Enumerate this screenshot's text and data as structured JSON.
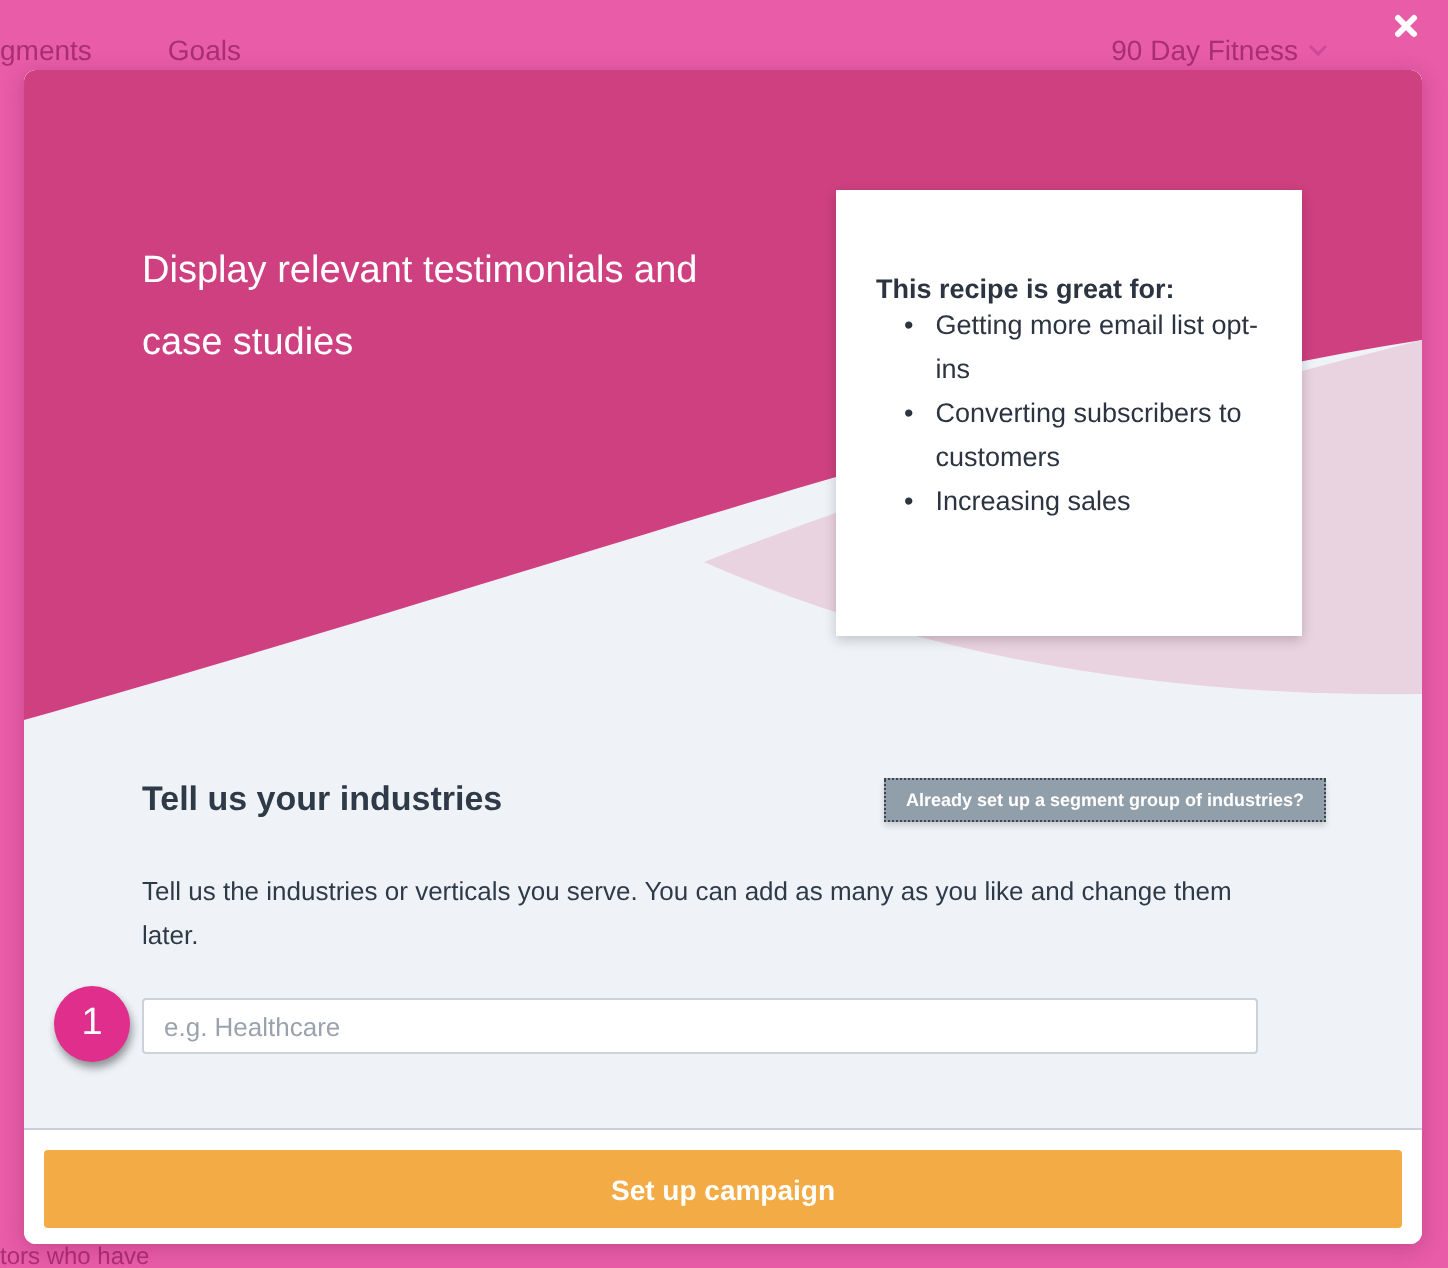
{
  "background_nav": {
    "items": [
      "gments",
      "Goals"
    ],
    "project": "90 Day Fitness"
  },
  "background_text": "tors who have",
  "modal": {
    "title": "Display relevant testimonials and case studies",
    "recipe_card": {
      "heading": "This recipe is great for:",
      "bullet": "•",
      "items": [
        "Getting more email list opt-ins",
        "Converting subscribers to customers",
        "Increasing sales"
      ]
    },
    "section_title": "Tell us your industries",
    "segment_button": "Already set up a segment group of industries?",
    "description": "Tell us the industries or verticals you serve. You can add as many as you like and change them later.",
    "step_badge": "1",
    "industry_field": {
      "placeholder": "e.g. Healthcare"
    },
    "submit_button": "Set up campaign"
  }
}
